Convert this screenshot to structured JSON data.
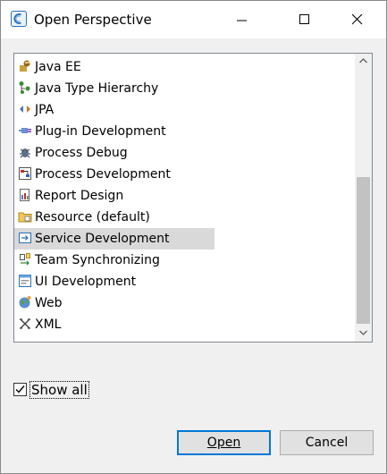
{
  "window": {
    "title": "Open Perspective",
    "icon": "perspective-icon"
  },
  "perspectives": {
    "items": [
      {
        "label": "Java EE",
        "icon": "java-ee-icon"
      },
      {
        "label": "Java Type Hierarchy",
        "icon": "type-hierarchy-icon"
      },
      {
        "label": "JPA",
        "icon": "jpa-icon"
      },
      {
        "label": "Plug-in Development",
        "icon": "plugin-icon"
      },
      {
        "label": "Process Debug",
        "icon": "process-debug-icon"
      },
      {
        "label": "Process Development",
        "icon": "process-development-icon"
      },
      {
        "label": "Report Design",
        "icon": "report-design-icon"
      },
      {
        "label": "Resource (default)",
        "icon": "resource-folder-icon"
      },
      {
        "label": "Service Development",
        "icon": "service-development-icon",
        "selected": true
      },
      {
        "label": "Team Synchronizing",
        "icon": "team-sync-icon"
      },
      {
        "label": "UI Development",
        "icon": "ui-development-icon"
      },
      {
        "label": "Web",
        "icon": "web-globe-icon"
      },
      {
        "label": "XML",
        "icon": "xml-icon"
      }
    ]
  },
  "options": {
    "show_all_label": "Show all",
    "show_all_checked": true
  },
  "buttons": {
    "open_label": "Open",
    "cancel_label": "Cancel"
  },
  "colors": {
    "selection": "#d9d9d9",
    "default_button_border": "#0078d7",
    "accent": "#2d6fb5"
  }
}
